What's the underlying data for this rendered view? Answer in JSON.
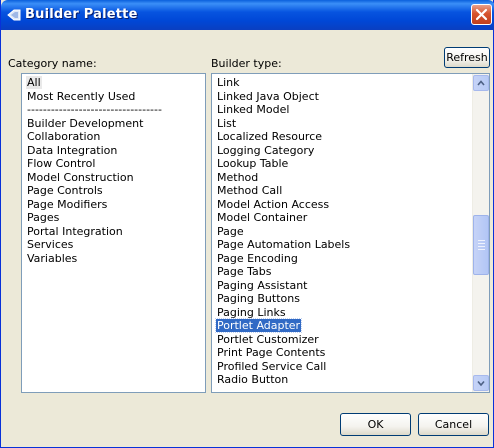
{
  "window": {
    "title": "Builder Palette",
    "title_icon": "palette-icon",
    "close_icon": "close-icon"
  },
  "category": {
    "label": "Category name:",
    "items": [
      "All",
      "Most Recently Used",
      "----------------------------------",
      "Builder Development",
      "Collaboration",
      "Data Integration",
      "Flow Control",
      "Model Construction",
      "Page Controls",
      "Page Modifiers",
      "Pages",
      "Portal Integration",
      "Services",
      "Variables"
    ],
    "selected": "All"
  },
  "builder": {
    "label": "Builder type:",
    "items": [
      "Link",
      "Linked Java Object",
      "Linked Model",
      "List",
      "Localized Resource",
      "Logging Category",
      "Lookup Table",
      "Method",
      "Method Call",
      "Model Action Access",
      "Model Container",
      "Page",
      "Page Automation Labels",
      "Page Encoding",
      "Page Tabs",
      "Paging Assistant",
      "Paging Buttons",
      "Paging Links",
      "Portlet Adapter",
      "Portlet Customizer",
      "Print Page Contents",
      "Profiled Service Call",
      "Radio Button"
    ],
    "selected": "Portlet Adapter"
  },
  "buttons": {
    "refresh": "Refresh",
    "ok": "OK",
    "cancel": "Cancel"
  },
  "colors": {
    "title_bar": "#0a5fdc",
    "selection": "#316ac5",
    "window_bg": "#ece9d8"
  }
}
